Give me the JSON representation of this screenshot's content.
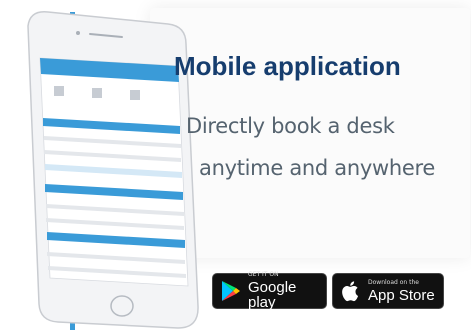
{
  "hero": {
    "title": "Mobile application",
    "tagline_line1": "Directly book a desk",
    "tagline_line2": "anytime and anywhere"
  },
  "badges": {
    "google": {
      "small": "GET IT ON",
      "big": "Google play",
      "icon": "google-play-icon"
    },
    "apple": {
      "small": "Download on the",
      "big": "App Store",
      "icon": "apple-icon"
    }
  },
  "colors": {
    "title": "#163d6e",
    "tagline": "#55636f",
    "accent": "#3a9bd8",
    "badge_bg": "#111111"
  }
}
